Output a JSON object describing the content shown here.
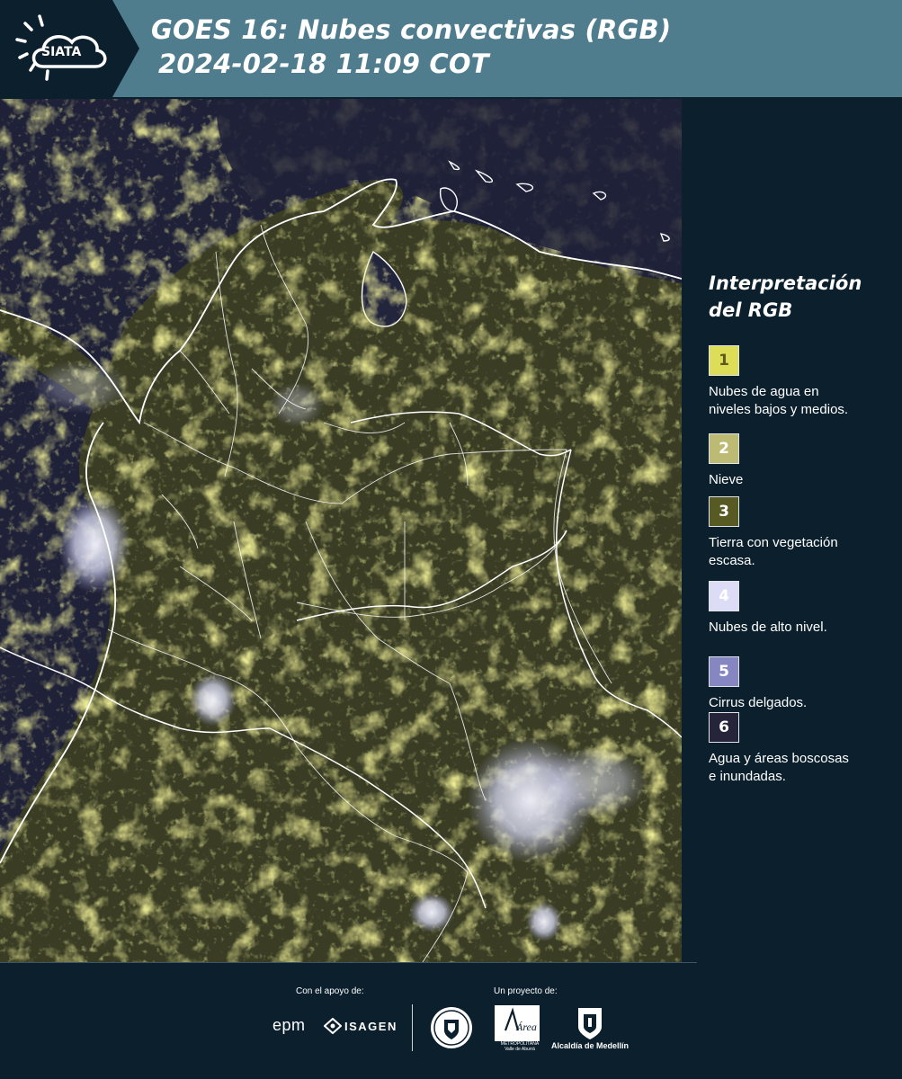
{
  "header": {
    "logo_text": "SIATA",
    "title_line1": "GOES 16: Nubes convectivas (RGB)",
    "title_line2": "2024-02-18 11:09 COT"
  },
  "map": {
    "product": "GOES 16 Nubes convectivas RGB",
    "colors": {
      "background": "#1e2036",
      "land": "#3b3f24",
      "low_clouds": "#d9d84a",
      "high_clouds": "#d6d9f2",
      "water": "#23253d",
      "borders": "#ffffff"
    }
  },
  "legend": {
    "title_line1": "Interpretación",
    "title_line2": "del RGB",
    "items": [
      {
        "number": "1",
        "label_line1": "Nubes de agua en",
        "label_line2": "niveles bajos y medios.",
        "color": "#dedd57",
        "text_color": "#5d5a20"
      },
      {
        "number": "2",
        "label_line1": "Nieve",
        "label_line2": "",
        "color": "#bdbb73",
        "text_color": "#ffffff"
      },
      {
        "number": "3",
        "label_line1": "Tierra con vegetación",
        "label_line2": "escasa.",
        "color": "#585a23",
        "text_color": "#ffffff"
      },
      {
        "number": "4",
        "label_line1": "Nubes de alto nivel.",
        "label_line2": "",
        "color": "#dcdcf7",
        "text_color": "#ffffff"
      },
      {
        "number": "5",
        "label_line1": "Cirrus delgados.",
        "label_line2": "",
        "color": "#8686c2",
        "text_color": "#ffffff"
      },
      {
        "number": "6",
        "label_line1": "Agua y áreas boscosas",
        "label_line2": "e inundadas.",
        "color": "#25243b",
        "text_color": "#ffffff"
      }
    ]
  },
  "footer": {
    "support_label": "Con el apoyo de:",
    "project_label": "Un proyecto de:",
    "sponsor_1": "epm",
    "sponsor_2": "ISAGEN",
    "partner_area_name": "Área",
    "partner_area_sub1": "METROPOLITANA",
    "partner_area_sub2": "Valle de Aburrá",
    "partner_medellin": "Alcaldía de Medellín"
  }
}
